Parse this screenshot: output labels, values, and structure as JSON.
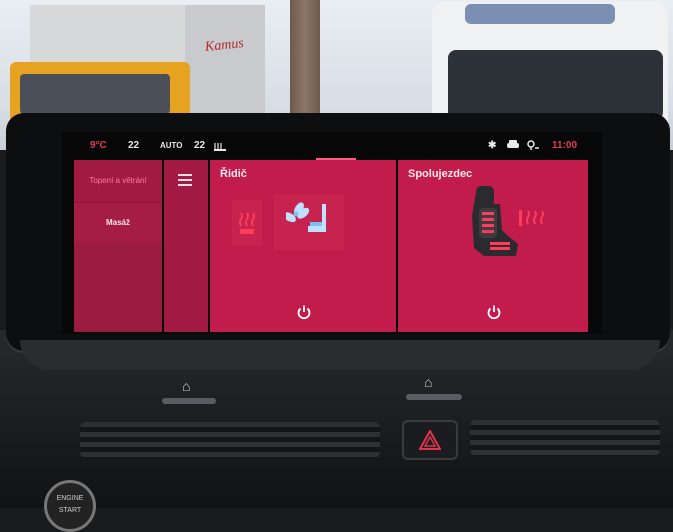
{
  "status_bar": {
    "outside_temp": "9°C",
    "left_temp": "22",
    "mode": "AUTO",
    "right_temp": "22",
    "time": "11:00",
    "icons": [
      "seat-heat-icon",
      "bluetooth-icon",
      "car-status-icon",
      "location-icon"
    ]
  },
  "side_menu": {
    "items": [
      {
        "label": "Topení a větrání",
        "active": true
      },
      {
        "label": "Masáž",
        "active": false
      }
    ]
  },
  "driver": {
    "title": "Řidič",
    "icons": [
      "seat-heat-icon",
      "seat-ventilation-icon",
      "power-icon"
    ]
  },
  "passenger": {
    "title": "Spolujezdec",
    "icons": [
      "seat-image",
      "seat-heat-icon",
      "power-icon"
    ]
  },
  "colors": {
    "panel": "#c21c4c",
    "accent": "#e23b53"
  },
  "background": {
    "truck_text": "Kamus"
  }
}
